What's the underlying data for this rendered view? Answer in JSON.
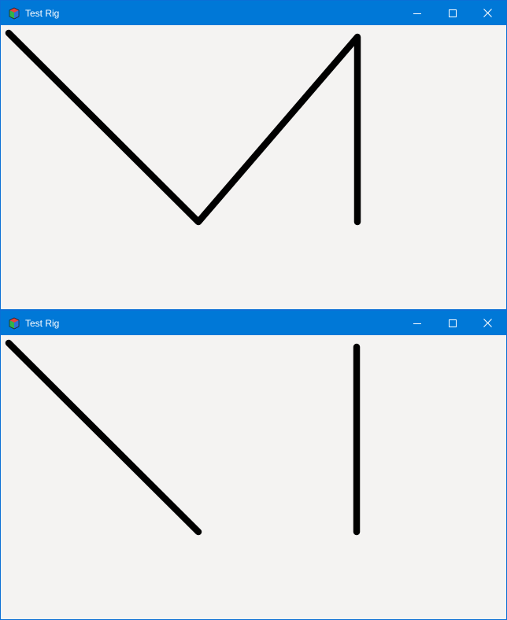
{
  "windows": [
    {
      "title": "Test Rig",
      "icons": {
        "app": "cube-app-icon",
        "minimize": "minimize-icon",
        "maximize": "maximize-icon",
        "close": "close-icon"
      },
      "stroke_color": "#000000"
    },
    {
      "title": "Test Rig",
      "icons": {
        "app": "cube-app-icon",
        "minimize": "minimize-icon",
        "maximize": "maximize-icon",
        "close": "close-icon"
      },
      "stroke_color": "#000000"
    }
  ],
  "colors": {
    "titlebar": "#0078d7",
    "client_background": "#f4f3f2",
    "title_text": "#ffffff"
  }
}
